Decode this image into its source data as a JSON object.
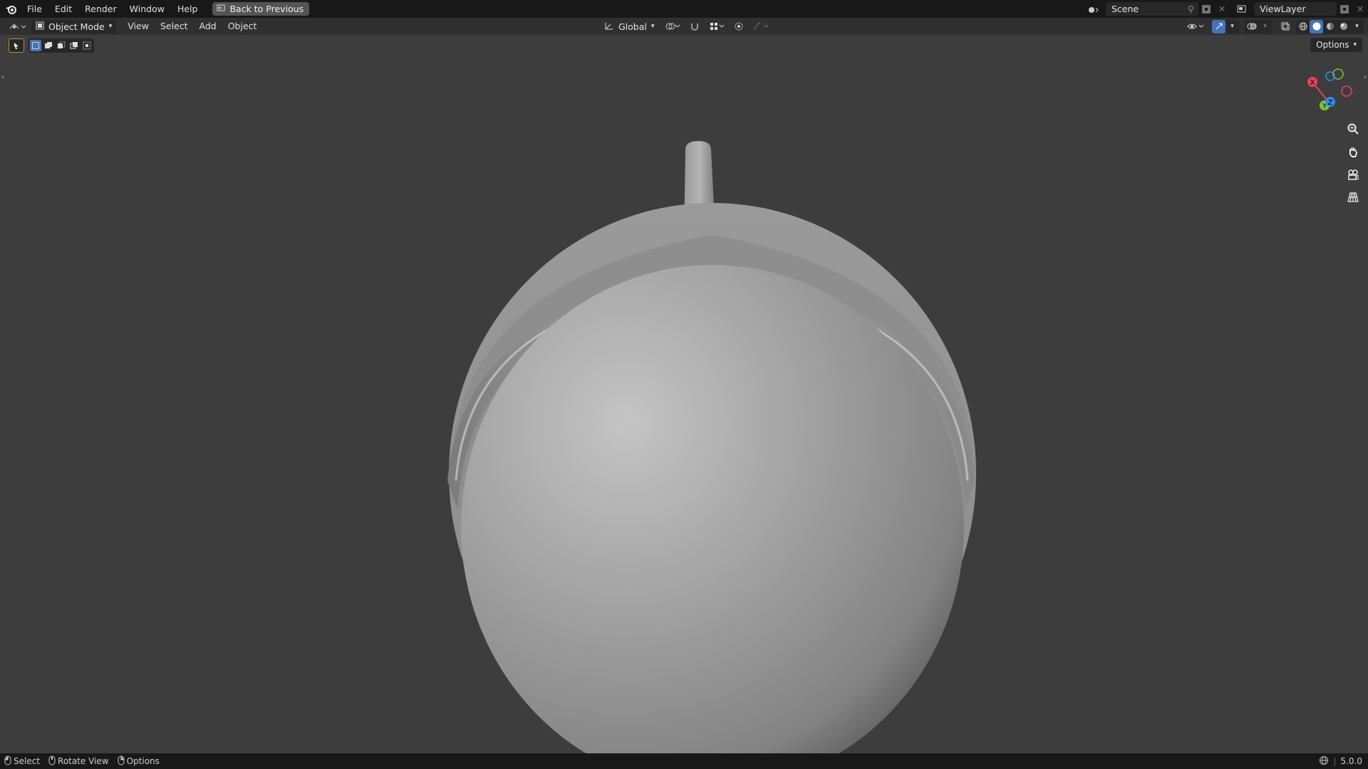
{
  "topbar": {
    "menu": [
      "File",
      "Edit",
      "Render",
      "Window",
      "Help"
    ],
    "back_label": "Back to Previous",
    "scene_value": "Scene",
    "viewlayer_value": "ViewLayer"
  },
  "header": {
    "mode_label": "Object Mode",
    "menu": [
      "View",
      "Select",
      "Add",
      "Object"
    ],
    "orientation_label": "Global"
  },
  "toolbar": {
    "options_label": "Options"
  },
  "gizmo": {
    "x_label": "X",
    "y_label": "Y",
    "z_label": "Z"
  },
  "statusbar": {
    "select_label": "Select",
    "rotate_label": "Rotate View",
    "options_label": "Options",
    "version": "5.0.0"
  },
  "colors": {
    "accent": "#4772b3",
    "x_axis": "#e8435a",
    "y_axis": "#7fc43d",
    "z_axis": "#2c8fe8",
    "background": "#3d3d3d"
  }
}
